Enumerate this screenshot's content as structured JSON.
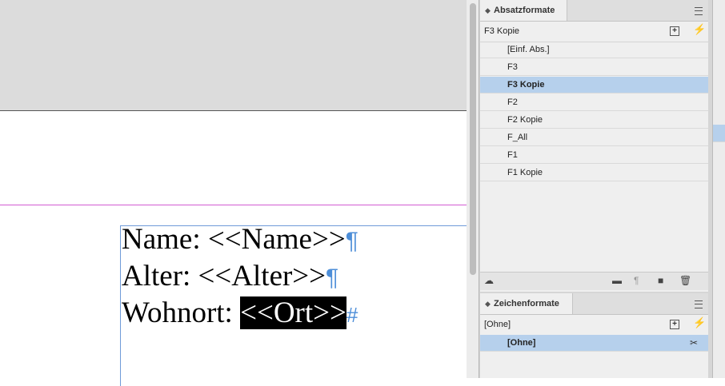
{
  "document": {
    "lines": [
      {
        "text": "Name: <<Name>>",
        "mark": "¶"
      },
      {
        "text": "Alter: <<Alter>>",
        "mark": "¶"
      },
      {
        "prefix": "Wohnort: ",
        "selected": "<<Ort>>",
        "mark": "#"
      }
    ]
  },
  "paragraph_styles": {
    "tab_label": "Absatzformate",
    "current_style": "F3 Kopie",
    "items": [
      "[Einf. Abs.]",
      "F3",
      "F3 Kopie",
      "F2",
      "F2 Kopie",
      "F_All",
      "F1",
      "F1 Kopie"
    ],
    "selected_index": 2
  },
  "character_styles": {
    "tab_label": "Zeichenformate",
    "current_style": "[Ohne]",
    "items": [
      "[Ohne]"
    ],
    "selected_index": 0
  },
  "colors": {
    "selection": "#b6d0ec",
    "guide": "#d25bd2",
    "frame": "#6f9bd8"
  }
}
